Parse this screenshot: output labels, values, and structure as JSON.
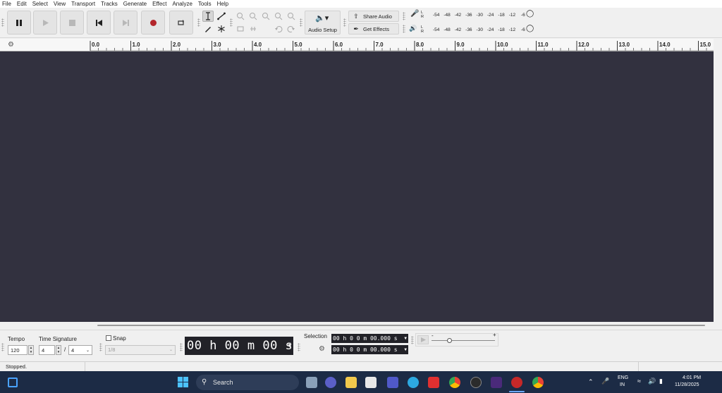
{
  "menu": [
    "File",
    "Edit",
    "Select",
    "View",
    "Transport",
    "Tracks",
    "Generate",
    "Effect",
    "Analyze",
    "Tools",
    "Help"
  ],
  "toolbar": {
    "audio_setup": "Audio Setup",
    "share_audio": "Share Audio",
    "get_effects": "Get Effects",
    "meter_channels": "L\nR",
    "meter_ticks": [
      "-54",
      "-48",
      "-42",
      "-36",
      "-30",
      "-24",
      "-18",
      "-12",
      "-6"
    ]
  },
  "ruler": {
    "ticks": [
      "0.0",
      "1.0",
      "2.0",
      "3.0",
      "4.0",
      "5.0",
      "6.0",
      "7.0",
      "8.0",
      "9.0",
      "10.0",
      "11.0",
      "12.0",
      "13.0",
      "14.0",
      "15.0"
    ]
  },
  "bottom": {
    "tempo_label": "Tempo",
    "tempo_value": "120",
    "timesig_label": "Time Signature",
    "timesig_num": "4",
    "timesig_sep": "/",
    "timesig_den": "4",
    "snap_label": "Snap",
    "snap_value": "1/8",
    "time_display": "00 h 00 m 00 s",
    "selection_label": "Selection",
    "selection_start": "00 h 0 0 m 00.000 s",
    "selection_end": "00 h 0 0 m 00.000 s",
    "speed_minus": "-",
    "speed_plus": "+",
    "play_speed": 0.29
  },
  "status": {
    "text": "Stopped."
  },
  "taskbar": {
    "search": "Search",
    "lang_line1": "ENG",
    "lang_line2": "IN",
    "time": "4:01 PM",
    "date": "11/28/2025"
  },
  "colors": {
    "track_bg": "#32313f",
    "taskbar_bg": "#1c2b45",
    "record": "#b3262b"
  }
}
